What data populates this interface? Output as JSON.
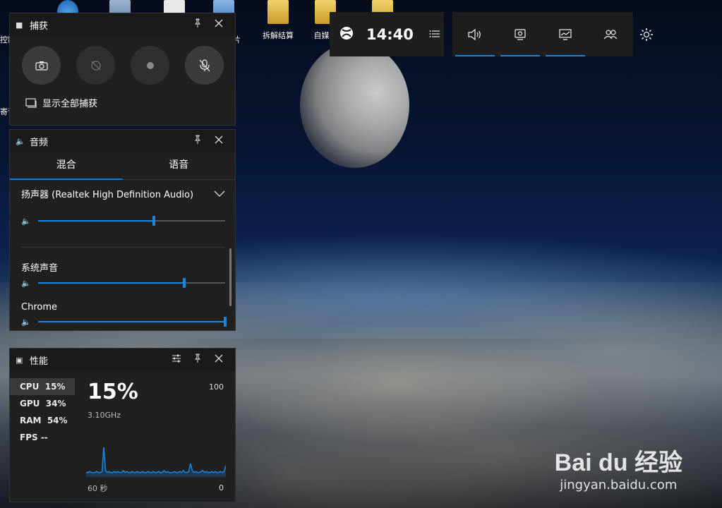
{
  "desktop": {
    "icons": [
      {
        "label": "拆解结算"
      },
      {
        "label": "自媒体"
      }
    ],
    "left_fragments": [
      "控制",
      "片",
      "寄语"
    ]
  },
  "capture": {
    "title": "捕获",
    "show_all": "显示全部捕获"
  },
  "audio": {
    "title": "音频",
    "tabs": [
      "混合",
      "语音"
    ],
    "active_tab": "混合",
    "device": "扬声器 (Realtek High Definition Audio)",
    "master_level": 0.62,
    "apps": [
      {
        "name": "系统声音",
        "level": 0.78
      },
      {
        "name": "Chrome",
        "level": 1.0
      }
    ]
  },
  "performance": {
    "title": "性能",
    "metrics": [
      {
        "label": "CPU",
        "value": "15%"
      },
      {
        "label": "GPU",
        "value": "34%"
      },
      {
        "label": "RAM",
        "value": "54%"
      },
      {
        "label": "FPS",
        "value": "--"
      }
    ],
    "selected": "CPU",
    "big_value": "15%",
    "frequency": "3.10GHz",
    "max_label": "100",
    "min_label": "0",
    "time_label": "60 秒",
    "graph": [
      3,
      3,
      4,
      3,
      3,
      3,
      4,
      3,
      3,
      4,
      28,
      5,
      3,
      4,
      3,
      3,
      4,
      3,
      4,
      3,
      3,
      5,
      3,
      4,
      3,
      3,
      4,
      3,
      3,
      4,
      3,
      3,
      4,
      3,
      3,
      4,
      3,
      3,
      4,
      3,
      3,
      4,
      3,
      3,
      5,
      3,
      4,
      3,
      3,
      3,
      4,
      3,
      3,
      4,
      3,
      5,
      3,
      3,
      4,
      12,
      5,
      3,
      4,
      3,
      3,
      4,
      5,
      3,
      4,
      3,
      3,
      4,
      3,
      4,
      3,
      3,
      4,
      3,
      4,
      10
    ]
  },
  "topbar": {
    "time": "14:40"
  },
  "watermark": {
    "logo": "Bai du 经验",
    "url": "jingyan.baidu.com"
  },
  "colors": {
    "accent": "#1a86e0",
    "panel_bg": "#202020"
  }
}
